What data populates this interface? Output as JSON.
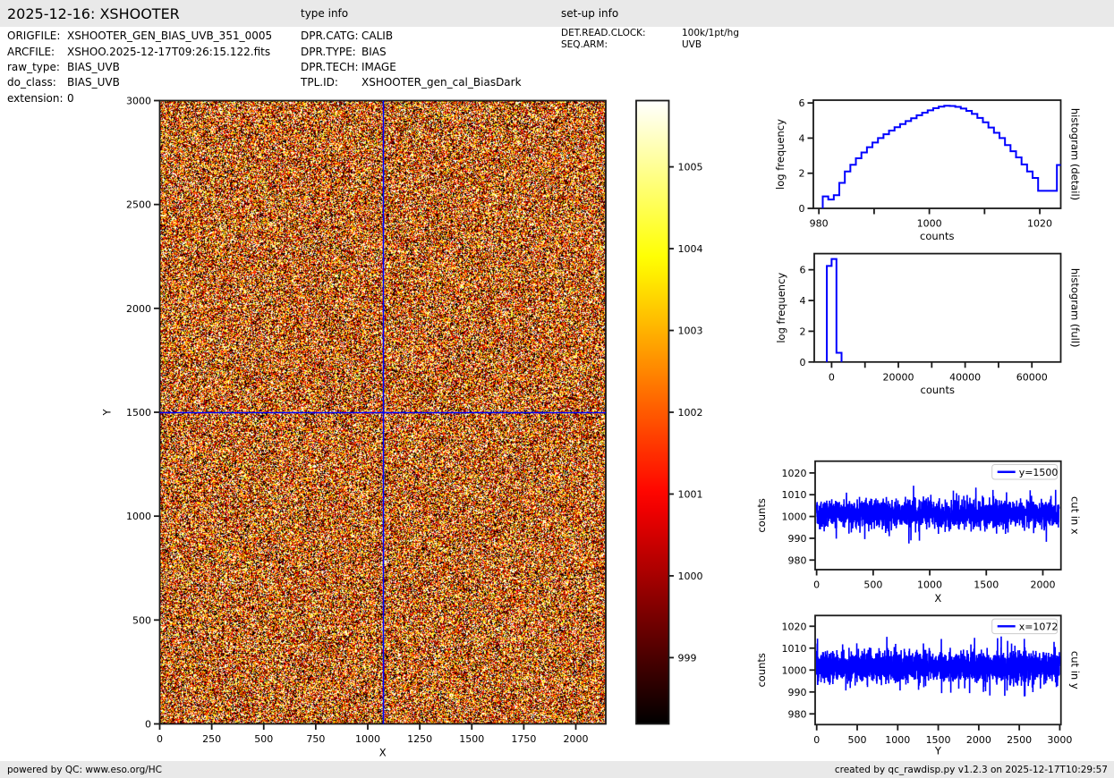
{
  "header": {
    "title": "2025-12-16: XSHOOTER",
    "type_info_label": "type info",
    "setup_info_label": "set-up info"
  },
  "file_info": {
    "rows": [
      {
        "label": "ORIGFILE:",
        "value": "XSHOOTER_GEN_BIAS_UVB_351_0005"
      },
      {
        "label": "ARCFILE:",
        "value": "XSHOO.2025-12-17T09:26:15.122.fits"
      },
      {
        "label": "raw_type:",
        "value": "BIAS_UVB"
      },
      {
        "label": "do_class:",
        "value": "BIAS_UVB"
      },
      {
        "label": "extension:",
        "value": "0"
      }
    ]
  },
  "type_info": {
    "rows": [
      {
        "label": "DPR.CATG:",
        "value": "CALIB"
      },
      {
        "label": "DPR.TYPE:",
        "value": "BIAS"
      },
      {
        "label": "DPR.TECH:",
        "value": "IMAGE"
      },
      {
        "label": "TPL.ID:",
        "value": "XSHOOTER_gen_cal_BiasDark"
      }
    ]
  },
  "setup_info": {
    "rows": [
      {
        "label": "DET.READ.CLOCK:",
        "value": "100k/1pt/hg"
      },
      {
        "label": "SEQ.ARM:",
        "value": "UVB"
      }
    ]
  },
  "footer": {
    "left": "powered by QC: www.eso.org/HC",
    "right": "created by qc_rawdisp.py v1.2.3 on 2025-12-17T10:29:57"
  },
  "colors": {
    "line_blue": "#0000ff",
    "spine_black": "#1a1a1a",
    "bar_grey": "#e9e9e9",
    "legend_edge": "#cccccc"
  },
  "chart_data": [
    {
      "id": "main_image",
      "type": "heatmap",
      "xlabel": "X",
      "ylabel": "Y",
      "x_range": [
        0,
        2144
      ],
      "y_range": [
        0,
        3000
      ],
      "x_ticks": [
        0,
        250,
        500,
        750,
        1000,
        1250,
        1500,
        1750,
        2000
      ],
      "y_ticks": [
        0,
        500,
        1000,
        1500,
        2000,
        2500,
        3000
      ],
      "colormap": "hot",
      "vmin": 998.19,
      "vmax": 1005.81,
      "noise_mean": 1001.8,
      "noise_sigma": 3.6,
      "crosshair": {
        "x": 1072,
        "y": 1500
      }
    },
    {
      "id": "colorbar",
      "type": "colorbar",
      "colormap": "hot",
      "vmin": 998.19,
      "vmax": 1005.81,
      "ticks": [
        999,
        1000,
        1001,
        1002,
        1003,
        1004,
        1005
      ]
    },
    {
      "id": "hist_detail",
      "type": "histogram-step",
      "xlabel": "counts",
      "ylabel": "log frequency",
      "right_label": "histogram (detail)",
      "x_range": [
        979.0,
        1023.8
      ],
      "y_range": [
        0,
        6.16
      ],
      "x_ticks": [
        980,
        990,
        1000,
        1010,
        1020
      ],
      "x_tick_labels": {
        "980": "980",
        "1000": "1000",
        "1020": "1020"
      },
      "y_ticks": [
        0,
        2,
        4,
        6
      ],
      "edges": [
        980.7,
        981.7,
        982.7,
        983.7,
        984.7,
        985.7,
        986.7,
        987.7,
        988.7,
        989.7,
        990.7,
        991.7,
        992.7,
        993.7,
        994.7,
        995.7,
        996.7,
        997.7,
        998.7,
        999.7,
        1000.7,
        1001.7,
        1002.7,
        1003.7,
        1004.7,
        1005.7,
        1006.7,
        1007.7,
        1008.7,
        1009.7,
        1010.7,
        1011.7,
        1012.7,
        1013.7,
        1014.7,
        1015.7,
        1016.7,
        1017.7,
        1018.7,
        1019.7,
        1023.1,
        1023.8
      ],
      "levels": [
        0.68,
        0.5,
        0.75,
        1.45,
        2.1,
        2.48,
        2.85,
        3.18,
        3.48,
        3.75,
        4.0,
        4.22,
        4.43,
        4.62,
        4.8,
        4.97,
        5.13,
        5.3,
        5.45,
        5.58,
        5.7,
        5.79,
        5.84,
        5.83,
        5.78,
        5.68,
        5.55,
        5.38,
        5.15,
        4.9,
        4.6,
        4.3,
        4.0,
        3.6,
        3.25,
        2.9,
        2.5,
        2.1,
        1.73,
        1.0,
        2.47
      ],
      "close_start": true,
      "close_end": false
    },
    {
      "id": "hist_full",
      "type": "histogram-step",
      "xlabel": "counts",
      "ylabel": "log frequency",
      "right_label": "histogram (full)",
      "x_range": [
        -5200,
        68650
      ],
      "y_range": [
        0,
        7.05
      ],
      "x_ticks": [
        0,
        10000,
        20000,
        30000,
        40000,
        50000,
        60000
      ],
      "x_tick_labels": {
        "0": "0",
        "20000": "20000",
        "40000": "40000",
        "60000": "60000"
      },
      "y_ticks": [
        0,
        2,
        4,
        6
      ],
      "edges": [
        -1430,
        0,
        1450,
        2980
      ],
      "levels": [
        6.25,
        6.7,
        0.6
      ],
      "close_start": true,
      "close_end": true
    },
    {
      "id": "cut_x",
      "type": "line",
      "xlabel": "X",
      "ylabel": "counts",
      "right_label": "cut in x",
      "legend": "y=1500",
      "x_range": [
        -13,
        2160
      ],
      "y_range": [
        975.6,
        1025.4
      ],
      "x_ticks": [
        0,
        500,
        1000,
        1500,
        2000
      ],
      "y_ticks": [
        980,
        990,
        1000,
        1010,
        1020
      ],
      "series": {
        "n": 2144,
        "mean": 1001.2,
        "sigma": 3.3,
        "seed": 77
      },
      "observed": {
        "min": 988,
        "max": 1015
      }
    },
    {
      "id": "cut_y",
      "type": "line",
      "xlabel": "Y",
      "ylabel": "counts",
      "right_label": "cut in y",
      "legend": "x=1072",
      "x_range": [
        -19,
        3014
      ],
      "y_range": [
        975.1,
        1024.9
      ],
      "x_ticks": [
        0,
        500,
        1000,
        1500,
        2000,
        2500,
        3000
      ],
      "y_ticks": [
        980,
        990,
        1000,
        1010,
        1020
      ],
      "series": {
        "n": 3000,
        "mean": 1001.5,
        "sigma": 3.3,
        "seed": 991
      },
      "observed": {
        "min": 989,
        "max": 1016
      }
    }
  ]
}
